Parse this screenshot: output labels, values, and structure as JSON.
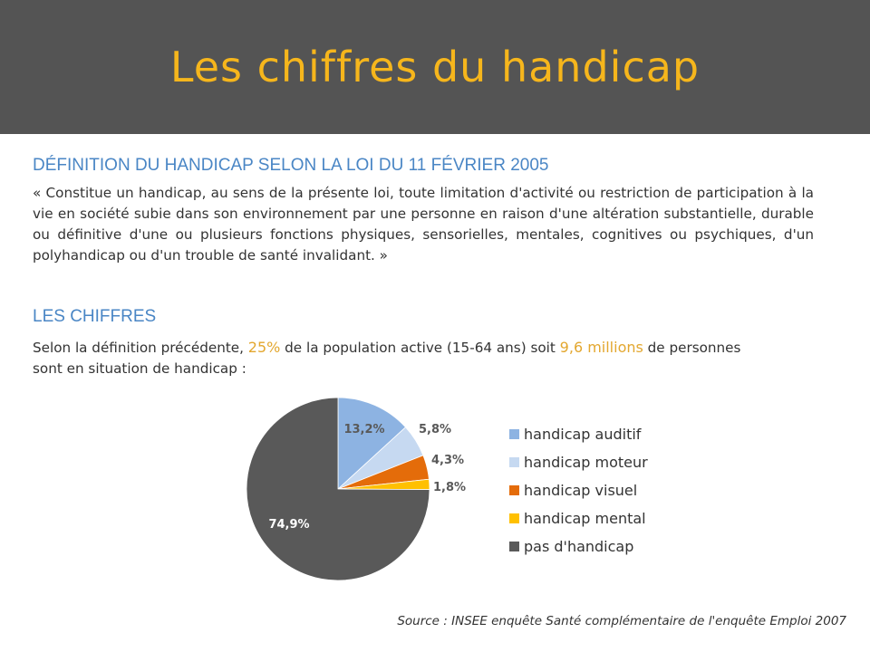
{
  "slide": {
    "title": "Les chiffres du handicap",
    "definition_heading": "DÉFINITION DU HANDICAP SELON LA LOI DU 11 FÉVRIER 2005",
    "definition_text": "« Constitue un handicap, au sens de la présente loi, toute limitation d'activité ou restriction de participation à la vie en société subie dans son environnement par une personne en raison d'une altération substantielle, durable ou définitive d'une ou plusieurs fonctions physiques, sensorielles, mentales, cognitives ou psychiques, d'un polyhandicap ou d'un trouble de santé invalidant. »",
    "chiffres_heading": "LES CHIFFRES",
    "stats_part1": "Selon la définition précédente, ",
    "stats_highlight1": "25%",
    "stats_part2": " de la population active (15-64 ans) soit ",
    "stats_highlight2": "9,6 millions",
    "stats_part3": " de personnes sont en situation de handicap :",
    "source": "Source : INSEE enquête Santé complémentaire de l'enquête Emploi 2007"
  },
  "colors": {
    "title_bar": "#545454",
    "title_text": "#f6b61c",
    "heading": "#4a86c5",
    "highlight": "#e3a72f"
  },
  "chart_data": {
    "type": "pie",
    "title": "",
    "legend_position": "right",
    "slices": [
      {
        "name": "handicap auditif",
        "value": 13.2,
        "label": "13,2%",
        "color": "#8db3e2"
      },
      {
        "name": "handicap moteur",
        "value": 5.8,
        "label": "5,8%",
        "color": "#c6d9f1"
      },
      {
        "name": "handicap visuel",
        "value": 4.3,
        "label": "4,3%",
        "color": "#e46c0a"
      },
      {
        "name": "handicap mental",
        "value": 1.8,
        "label": "1,8%",
        "color": "#ffc000"
      },
      {
        "name": "pas d'handicap",
        "value": 74.9,
        "label": "74,9%",
        "color": "#595959"
      }
    ]
  }
}
